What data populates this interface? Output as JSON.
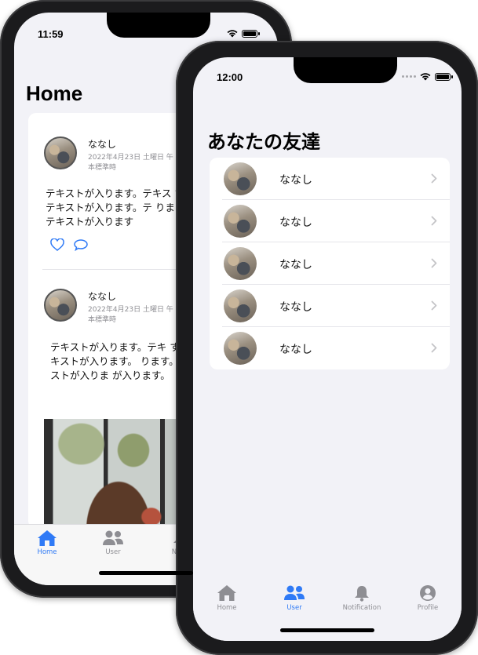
{
  "colors": {
    "accent": "#2f7af6",
    "inactive": "#8e8e93",
    "background": "#f2f2f7",
    "card": "#ffffff"
  },
  "back_phone": {
    "status": {
      "time": "11:59"
    },
    "title": "Home",
    "posts": [
      {
        "author": "ななし",
        "date": "2022年4月23日 土曜日 午",
        "timezone": "本標準時",
        "text": "テキストが入ります。テキス す。テキストが入ります。テ ります。テキストが入ります",
        "actions": [
          "heart-icon",
          "comment-icon"
        ]
      },
      {
        "author": "ななし",
        "date": "2022年4月23日 土曜日 午",
        "timezone": "本標準時",
        "text": "テキストが入ります。テキ す。テキストが入ります。 ります。テキストが入りま が入ります。",
        "has_photo": true
      }
    ],
    "tabs": [
      {
        "label": "Home",
        "icon": "house-icon",
        "active": true
      },
      {
        "label": "User",
        "icon": "users-icon",
        "active": false
      },
      {
        "label": "Notifi",
        "icon": "bell-icon",
        "active": false
      }
    ]
  },
  "front_phone": {
    "status": {
      "time": "12:00"
    },
    "title": "あなたの友達",
    "friends": [
      {
        "name": "ななし"
      },
      {
        "name": "ななし"
      },
      {
        "name": "ななし"
      },
      {
        "name": "ななし"
      },
      {
        "name": "ななし"
      }
    ],
    "tabs": [
      {
        "label": "Home",
        "icon": "house-icon",
        "active": false
      },
      {
        "label": "User",
        "icon": "users-icon",
        "active": true
      },
      {
        "label": "Notification",
        "icon": "bell-icon",
        "active": false
      },
      {
        "label": "Profile",
        "icon": "person-circle-icon",
        "active": false
      }
    ]
  }
}
